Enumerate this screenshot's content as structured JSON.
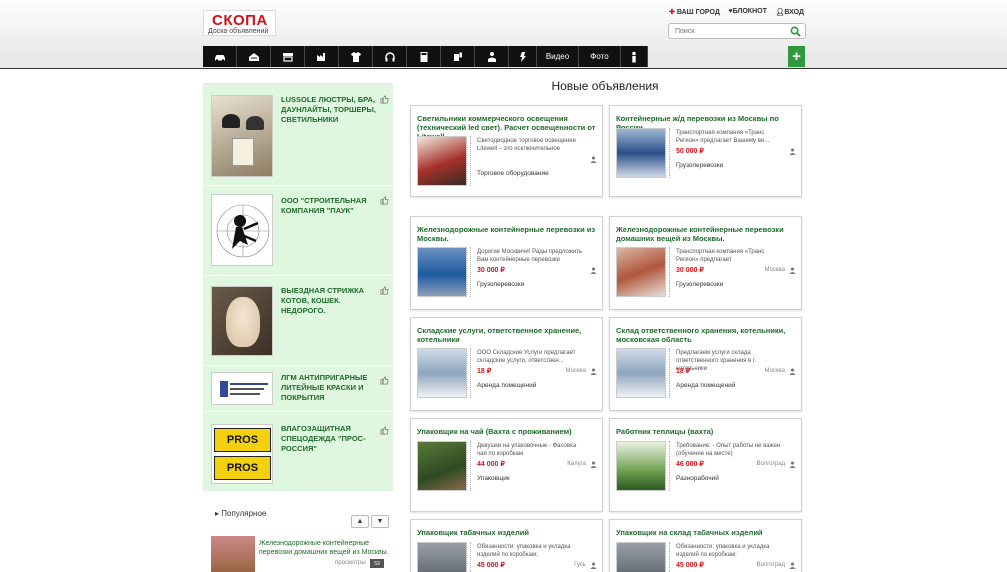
{
  "header": {
    "logo_title": "СКОПА",
    "logo_subtitle": "Доска объявлений",
    "links": [
      "ВАШ ГОРОД",
      "БЛОКНОТ",
      "ВХОД"
    ],
    "search_placeholder": "Поиск"
  },
  "nav": {
    "items": [
      {
        "icon": "car-icon"
      },
      {
        "icon": "house-icon"
      },
      {
        "icon": "store-icon"
      },
      {
        "icon": "factory-icon"
      },
      {
        "icon": "shirt-icon"
      },
      {
        "icon": "headphones-icon"
      },
      {
        "icon": "calculator-icon"
      },
      {
        "icon": "service-icon"
      },
      {
        "icon": "worker-icon"
      },
      {
        "icon": "child-icon"
      },
      {
        "label": "Видео"
      },
      {
        "label": "Фото"
      },
      {
        "icon": "person-icon"
      }
    ],
    "add_label": "+"
  },
  "sidebar": {
    "ads": [
      {
        "title": "LUSSOLE ЛЮСТРЫ, БРА, ДАУНЛАЙТЫ, ТОРШЕРЫ, СВЕТИЛЬНИКИ"
      },
      {
        "title": "ООО \"СТРОИТЕЛЬНАЯ КОМПАНИЯ \"ПАУК\""
      },
      {
        "title": "ВЫЕЗДНАЯ СТРИЖКА КОТОВ, КОШЕК. НЕДОРОГО."
      },
      {
        "title": "ЛГМ АНТИПРИГАРНЫЕ ЛИТЕЙНЫЕ КРАСКИ И ПОКРЫТИЯ"
      },
      {
        "title": "ВЛАГОЗАЩИТНАЯ СПЕЦОДЕЖДА \"ПРОС-РОССИЯ\"",
        "logo_text": "PROS"
      }
    ],
    "popular": {
      "heading": "Популярное",
      "item_title": "Железнодорожные контейнерные перевозки домашних вещей из Москвы.",
      "item_meta": "просмотры",
      "item_badge": "53"
    }
  },
  "main": {
    "title": "Новые объявления",
    "cards": [
      {
        "title": "Светильники коммерческого освещения (технический led свет). Расчет освещенности от Litewell.",
        "desc": "Светодиодное торговое освещение Litewell – это исключительное",
        "price": "",
        "city": "",
        "category": "Торговое оборудование"
      },
      {
        "title": "Контейнерные ж/д перевозки из Москвы по России.",
        "desc": "Транспортная компания «Транс Регион» предлагает Вашему вн...",
        "price": "50 000 ₽",
        "city": "",
        "category": "Грузоперевозки"
      },
      {
        "title": "Железнодорожные контейнерные перевозки из Москвы.",
        "desc": "Дорогие Москвичи! Рады предложить Вам контейнерные перевозки",
        "price": "30 000 ₽",
        "city": "",
        "category": "Грузоперевозки"
      },
      {
        "title": "Железнодорожные контейнерные перевозки домашних вещей из Москвы.",
        "desc": "Транспортная компания «Транс Регион» предлагает",
        "price": "30 000 ₽",
        "city": "Москва",
        "category": "Грузоперевозки"
      },
      {
        "title": "Складские услуги, ответственное хранение, котельники",
        "desc": "ООО Складские Услуги предлагает складские услуги, ответствен...",
        "price": "18 ₽",
        "city": "Москва",
        "category": "Аренда помещений"
      },
      {
        "title": "Склад ответственного хранения, котельники, московская область",
        "desc": "Предлагаем услуги склада ответственного хранения в г. котельники",
        "price": "18 ₽",
        "city": "Москва",
        "category": "Аренда помещений"
      },
      {
        "title": "Упаковщик на чай (Вахта с проживанием)",
        "desc": "Девушки на упаковочные - Фасовка чая по коробкам",
        "price": "44 000 ₽",
        "city": "Калуга",
        "category": "Упаковщик"
      },
      {
        "title": "Работник теплицы (вахта)",
        "desc": "Требование: - Опыт работы не важен (обучение на месте)",
        "price": "46 000 ₽",
        "city": "Волгоград",
        "category": "Разнорабочий"
      },
      {
        "title": "Упаковщик табачных изделий",
        "desc": "Обязанности: упаковка и укладка изделий по коробкам;",
        "price": "45 000 ₽",
        "city": "Гусь",
        "category": ""
      },
      {
        "title": "Упаковщик на склад табачных изделий",
        "desc": "Обязанности: упаковка и укладка изделий по коробкам;",
        "price": "45 000 ₽",
        "city": "Волгоград",
        "category": ""
      }
    ]
  },
  "colors": {
    "accent_green": "#1f6b2b",
    "price_red": "#d4111a",
    "ad_bg": "#dff7df",
    "nav_bg": "#111111",
    "add_green": "#2e9a3d"
  }
}
